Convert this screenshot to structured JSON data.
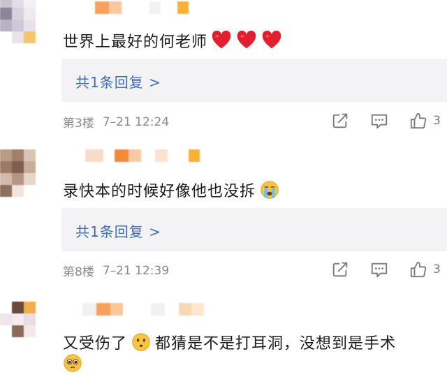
{
  "comments": [
    {
      "text": "世界上最好的何老师",
      "reply_link": "共1条回复 >",
      "floor": "第3楼",
      "time": "7–21 12:24",
      "like_count": "3",
      "emoji_after": [
        "red-heart",
        "red-heart",
        "red-heart"
      ]
    },
    {
      "text": "录快本的时候好像他也没拆",
      "reply_link": "共1条回复 >",
      "floor": "第8楼",
      "time": "7–21 12:39",
      "like_count": "3",
      "emoji_after": [
        "crying-face"
      ]
    },
    {
      "text_part1": "又受伤了",
      "text_part2": "都猜是不是打耳洞，没想到是手术",
      "emoji_inline": "hushed-face",
      "emoji_line2": "pleading-face"
    }
  ],
  "colors": {
    "link": "#3f6cb5",
    "reply_bg": "#f3f3f5",
    "meta": "#8a8a8a",
    "heart": "#e0202e"
  }
}
